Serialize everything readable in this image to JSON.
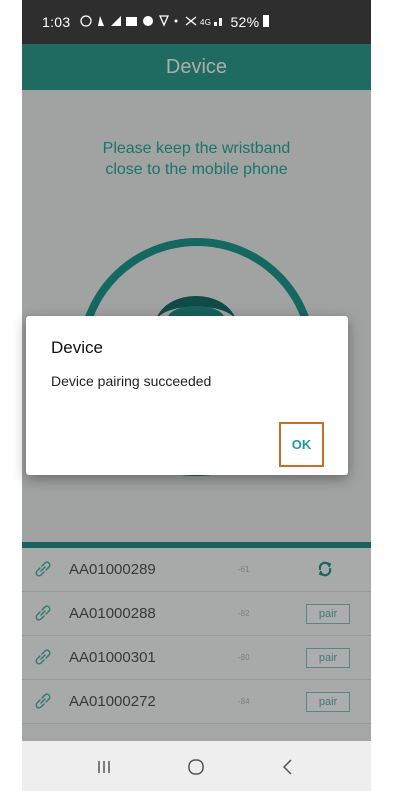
{
  "status_bar": {
    "time": "1:03",
    "battery": "52%",
    "icons": [
      "location",
      "notification",
      "mail",
      "app",
      "network",
      "signal"
    ]
  },
  "app_bar": {
    "title": "Device"
  },
  "hint": {
    "line1": "Please keep the wristband",
    "line2": "close to the mobile phone"
  },
  "devices": [
    {
      "name": "AA01000289",
      "rssi": "-61",
      "action": "refresh"
    },
    {
      "name": "AA01000288",
      "rssi": "-82",
      "action": "pair"
    },
    {
      "name": "AA01000301",
      "rssi": "-80",
      "action": "pair"
    },
    {
      "name": "AA01000272",
      "rssi": "-84",
      "action": "pair"
    }
  ],
  "pair_label": "pair",
  "dialog": {
    "title": "Device",
    "message": "Device pairing succeeded",
    "ok_label": "OK"
  },
  "colors": {
    "accent": "#2e9e8f",
    "highlight": "#c86f2c"
  }
}
